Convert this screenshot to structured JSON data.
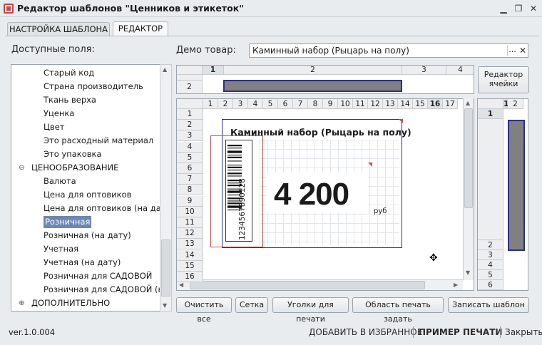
{
  "window": {
    "title": "Редактор шаблонов \"Ценников и этикеток\"",
    "minimize_icon": "minimize-icon",
    "restore_icon": "restore-icon",
    "close_icon": "close-icon"
  },
  "tabs": [
    {
      "label": "НАСТРОЙКА ШАБЛОНА",
      "active": false
    },
    {
      "label": "РЕДАКТОР",
      "active": true
    }
  ],
  "fields_panel": {
    "label": "Доступные поля:",
    "items": [
      {
        "label": "Старый код",
        "level": 2
      },
      {
        "label": "Страна производитель",
        "level": 2
      },
      {
        "label": "Ткань верха",
        "level": 2
      },
      {
        "label": "Уценка",
        "level": 2
      },
      {
        "label": "Цвет",
        "level": 2
      },
      {
        "label": "Это расходный материал",
        "level": 2
      },
      {
        "label": "Это упаковка",
        "level": 2
      },
      {
        "label": "ЦЕНООБРАЗОВАНИЕ",
        "level": 1,
        "toggle": "⊖"
      },
      {
        "label": "Валюта",
        "level": 2
      },
      {
        "label": "Цена для оптовиков",
        "level": 2
      },
      {
        "label": "Цена для оптовиков (на дату)",
        "level": 2
      },
      {
        "label": "Розничная",
        "level": 2,
        "selected": true
      },
      {
        "label": "Розничная (на дату)",
        "level": 2
      },
      {
        "label": "Учетная",
        "level": 2
      },
      {
        "label": "Учетная (на дату)",
        "level": 2
      },
      {
        "label": "Розничная для САДОВОЙ",
        "level": 2
      },
      {
        "label": "Розничная для САДОВОЙ (на д",
        "level": 2
      },
      {
        "label": "ДОПОЛНИТЕЛЬНО",
        "level": 1,
        "toggle": "⊕"
      }
    ]
  },
  "demo": {
    "label": "Демо товар:",
    "value": "Каминный набор (Рыцарь на полу)",
    "select_label": "...",
    "clear_label": "✕"
  },
  "cell_editor_button": "Редактор ячейки",
  "top_grid": {
    "columns": [
      "1",
      "2",
      "3",
      "4"
    ],
    "rows": [
      "1",
      "2"
    ]
  },
  "main_grid": {
    "columns": [
      "1",
      "2",
      "3",
      "4",
      "5",
      "6",
      "7",
      "8",
      "9",
      "10",
      "11",
      "12",
      "13",
      "14",
      "15",
      "16",
      "17"
    ],
    "rows": [
      "1",
      "2",
      "3",
      "4",
      "5",
      "6",
      "7",
      "8",
      "9",
      "10",
      "11",
      "12",
      "13",
      "14",
      "15",
      "16"
    ],
    "label_title": "Каминный набор (Рыцарь на полу)",
    "barcode_digits": "1234567890128",
    "price": "4 200",
    "currency": "руб"
  },
  "right_grid": {
    "columns": [
      "1",
      "2"
    ],
    "rows": [
      "1",
      "2",
      "3",
      "4",
      "5",
      "6"
    ]
  },
  "buttons": {
    "clear_all": "Очистить все",
    "grid": "Сетка",
    "print_corners": "Уголки для печати",
    "set_print_area": "Область печать задать",
    "save_template": "Записать шаблон"
  },
  "footer": {
    "version": "ver.1.0.004",
    "add_favorites": "ДОБАВИТЬ В ИЗБРАННОЕ",
    "print_example": "ПРИМЕР ПЕЧАТИ",
    "close": "Закрыть"
  },
  "colors": {
    "accent_blue": "#2b2e8f",
    "barcode_frame": "#d04a4a",
    "selection": "#6d87b2",
    "merged_cell": "#808080"
  }
}
